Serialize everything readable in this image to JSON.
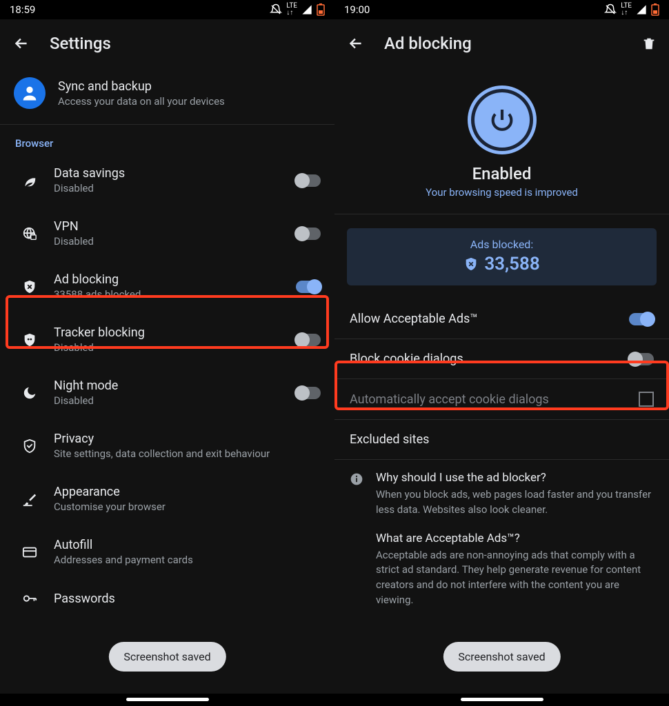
{
  "left": {
    "status_time": "18:59",
    "title": "Settings",
    "sync": {
      "title": "Sync and backup",
      "subtitle": "Access your data on all your devices"
    },
    "section_label": "Browser",
    "items": [
      {
        "title": "Data savings",
        "subtitle": "Disabled",
        "toggle": "off"
      },
      {
        "title": "VPN",
        "subtitle": "Disabled",
        "toggle": "off"
      },
      {
        "title": "Ad blocking",
        "subtitle": "33588 ads blocked",
        "toggle": "on"
      },
      {
        "title": "Tracker blocking",
        "subtitle": "Disabled",
        "toggle": "off"
      },
      {
        "title": "Night mode",
        "subtitle": "Disabled",
        "toggle": "off"
      },
      {
        "title": "Privacy",
        "subtitle": "Site settings, data collection and exit behaviour",
        "toggle": null
      },
      {
        "title": "Appearance",
        "subtitle": "Customise your browser",
        "toggle": null
      },
      {
        "title": "Autofill",
        "subtitle": "Addresses and payment cards",
        "toggle": null
      },
      {
        "title": "Passwords",
        "subtitle": "",
        "toggle": null
      }
    ],
    "toast": "Screenshot saved"
  },
  "right": {
    "status_time": "19:00",
    "title": "Ad blocking",
    "enabled_title": "Enabled",
    "enabled_subtitle": "Your browsing speed is improved",
    "stat_label": "Ads blocked:",
    "stat_value": "33,588",
    "rows": {
      "acceptable": "Allow Acceptable Ads™",
      "cookie": "Block cookie dialogs",
      "auto_accept": "Automatically accept cookie dialogs",
      "excluded": "Excluded sites"
    },
    "info1_q": "Why should I use the ad blocker?",
    "info1_a": "When you block ads, web pages load faster and you transfer less data. Websites also look cleaner.",
    "info2_q": "What are Acceptable Ads™?",
    "info2_a": "Acceptable ads are non-annoying ads that comply with a strict ad standard. They help generate revenue for content creators and do not interfere with the content you are viewing.",
    "toast": "Screenshot saved"
  }
}
